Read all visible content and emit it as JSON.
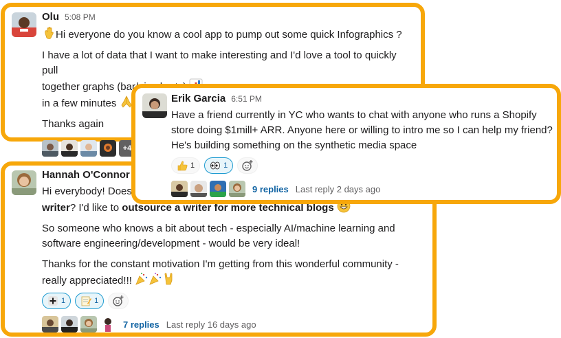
{
  "messages": {
    "olu": {
      "author": "Olu",
      "time": "5:08 PM",
      "line1": "Hi everyone do you know a cool app to pump out some quick Infographics ?",
      "para2_line1": "I have a lot of data that I want to make interesting and I'd love a tool to quickly pull",
      "para2_line2": "together graphs (bar/pie charts)",
      "para2_line3": "in a few minutes",
      "para3": "Thanks again",
      "reply_avatar_overflow": "+4"
    },
    "erik": {
      "author": "Erik Garcia",
      "time": "6:51 PM",
      "line1": "Have a friend currently in YC who wants to chat with anyone who runs a Shopify",
      "line2": "store doing $1mill+ ARR. Anyone here or willing to intro me so I can help my friend?",
      "line3": "He's building something on the synthetic media space",
      "reactions": [
        {
          "icon": "thumbs-up-icon",
          "count": "1"
        },
        {
          "icon": "eyes-icon",
          "count": "1"
        }
      ],
      "replies": "9 replies",
      "last_reply": "Last reply 2 days ago"
    },
    "hannah": {
      "author": "Hannah O'Connor",
      "line1_start": "Hi everybody! Does",
      "line2_bold1": "writer",
      "line2_mid": "? I'd like to",
      "line2_bold2": "outsource a writer for more technical blogs",
      "para2_line1": "So someone who knows a bit about tech - especially AI/machine learning and",
      "para2_line2": "software engineering/development - would be very ideal!",
      "para3_line1": "Thanks for the constant motivation I'm getting from this wonderful community -",
      "para3_line2": "really appreciated!!!",
      "reactions": [
        {
          "icon": "plus-icon",
          "count": "1"
        },
        {
          "icon": "memo-icon",
          "count": "1"
        }
      ],
      "replies": "7 replies",
      "last_reply": "Last reply 16 days ago"
    }
  },
  "colors": {
    "highlight_border": "#f7a70a",
    "link": "#1264a3",
    "reaction_selected_border": "#1d9bd1"
  }
}
